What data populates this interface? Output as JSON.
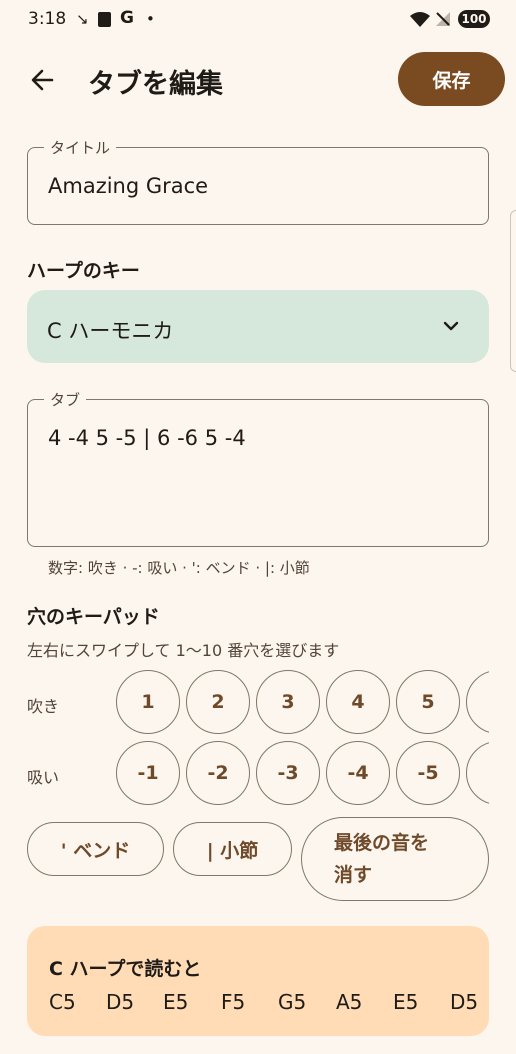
{
  "status": {
    "time": "3:18",
    "battery": "100",
    "icons": [
      "missed-call-icon",
      "sim-icon",
      "google-icon",
      "dot-icon",
      "wifi-icon",
      "no-signal-icon"
    ]
  },
  "app_bar": {
    "title": "タブを編集",
    "save_label": "保存"
  },
  "title_field": {
    "label": "タイトル",
    "value": "Amazing Grace"
  },
  "harp_key": {
    "section_label": "ハープのキー",
    "selected": "C ハーモニカ"
  },
  "tab_field": {
    "label": "タブ",
    "value": "4 -4 5 -5 | 6 -6 5 -4",
    "helper": "数字: 吹き · -: 吸い · ': ベンド · |: 小節"
  },
  "keypad": {
    "section_label": "穴のキーパッド",
    "hint": "左右にスワイプして 1〜10 番穴を選びます",
    "blow_label": "吹き",
    "draw_label": "吸い",
    "blow_holes": [
      "1",
      "2",
      "3",
      "4",
      "5"
    ],
    "draw_holes": [
      "-1",
      "-2",
      "-3",
      "-4",
      "-5"
    ]
  },
  "actions": {
    "bend": "' ベンド",
    "bar": "| 小節",
    "delete_last_1": "最後の音を",
    "delete_last_2": "消す"
  },
  "reading": {
    "title": "C ハープで読むと",
    "notes": [
      "C5",
      "D5",
      "E5",
      "F5",
      "G5",
      "A5",
      "E5",
      "D5"
    ]
  },
  "colors": {
    "background": "#fdf6ee",
    "primary": "#7a4a20",
    "key_select_bg": "#d6e8dc",
    "result_card_bg": "#ffdcb6"
  }
}
